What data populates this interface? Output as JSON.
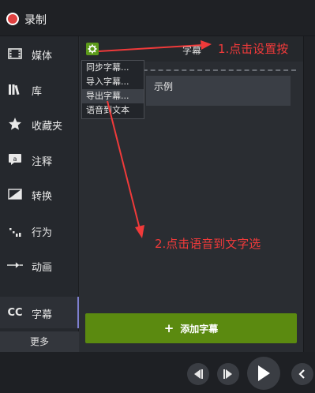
{
  "app": {
    "record_label": "录制"
  },
  "sidebar": {
    "items": [
      {
        "label": "媒体",
        "icon": "film-strip-icon"
      },
      {
        "label": "库",
        "icon": "library-icon"
      },
      {
        "label": "收藏夹",
        "icon": "star-icon"
      },
      {
        "label": "注释",
        "icon": "callout-icon"
      },
      {
        "label": "转换",
        "icon": "transition-icon"
      },
      {
        "label": "行为",
        "icon": "behavior-icon"
      },
      {
        "label": "动画",
        "icon": "animation-icon"
      },
      {
        "label": "字幕",
        "icon": "cc-icon",
        "badge": "CC"
      }
    ],
    "more_label": "更多"
  },
  "panel": {
    "header_title": "字幕",
    "gear_icon": "gear-icon",
    "caption_text": "示例",
    "menu": [
      "同步字幕...",
      "导入字幕...",
      "导出字幕...",
      "语音到文本"
    ],
    "add_button_label": "添加字幕"
  },
  "annotations": {
    "step1": "1.点击设置按",
    "step2": "2.点击语音到文字选"
  },
  "colors": {
    "accent_green": "#5b8a10",
    "record_red": "#e04141",
    "annotation_red": "#f03a3a",
    "active_indicator": "#7e7fcf"
  }
}
